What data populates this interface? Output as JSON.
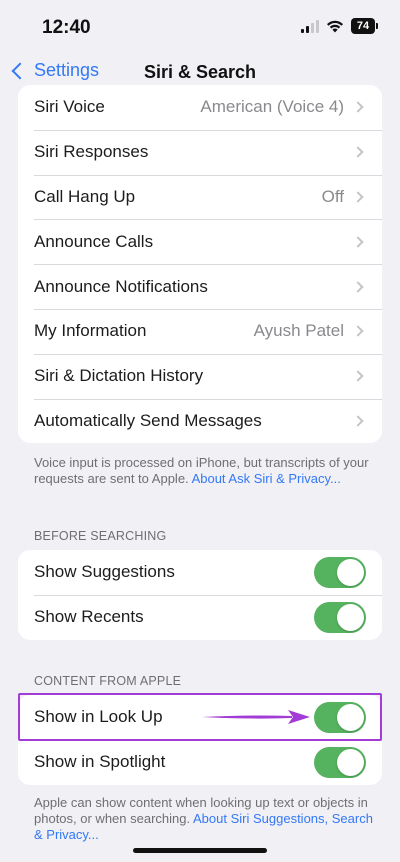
{
  "status_bar": {
    "time": "12:40",
    "battery": "74"
  },
  "nav": {
    "back_label": "Settings",
    "title": "Siri & Search"
  },
  "siri_group": {
    "rows": [
      {
        "label": "Siri Voice",
        "value": "American (Voice 4)"
      },
      {
        "label": "Siri Responses",
        "value": ""
      },
      {
        "label": "Call Hang Up",
        "value": "Off"
      },
      {
        "label": "Announce Calls",
        "value": ""
      },
      {
        "label": "Announce Notifications",
        "value": ""
      },
      {
        "label": "My Information",
        "value": "Ayush Patel"
      },
      {
        "label": "Siri & Dictation History",
        "value": ""
      },
      {
        "label": "Automatically Send Messages",
        "value": ""
      }
    ],
    "footnote_text": "Voice input is processed on iPhone, but transcripts of your requests are sent to Apple. ",
    "footnote_link": "About Ask Siri & Privacy..."
  },
  "before_searching": {
    "header": "BEFORE SEARCHING",
    "rows": [
      {
        "label": "Show Suggestions",
        "on": true
      },
      {
        "label": "Show Recents",
        "on": true
      }
    ]
  },
  "content_from_apple": {
    "header": "CONTENT FROM APPLE",
    "rows": [
      {
        "label": "Show in Look Up",
        "on": true
      },
      {
        "label": "Show in Spotlight",
        "on": true
      }
    ],
    "footnote_text": "Apple can show content when looking up text or objects in photos, or when searching. ",
    "footnote_link": "About Siri Suggestions, Search & Privacy..."
  },
  "colors": {
    "accent": "#3478f6",
    "toggle_on": "#55b25e",
    "highlight": "#a33cd6",
    "background": "#f0f0f5"
  },
  "icons": [
    "signal-icon",
    "wifi-icon",
    "battery-icon",
    "back-chevron-icon",
    "chevron-right-icon",
    "arrow-annotation"
  ]
}
